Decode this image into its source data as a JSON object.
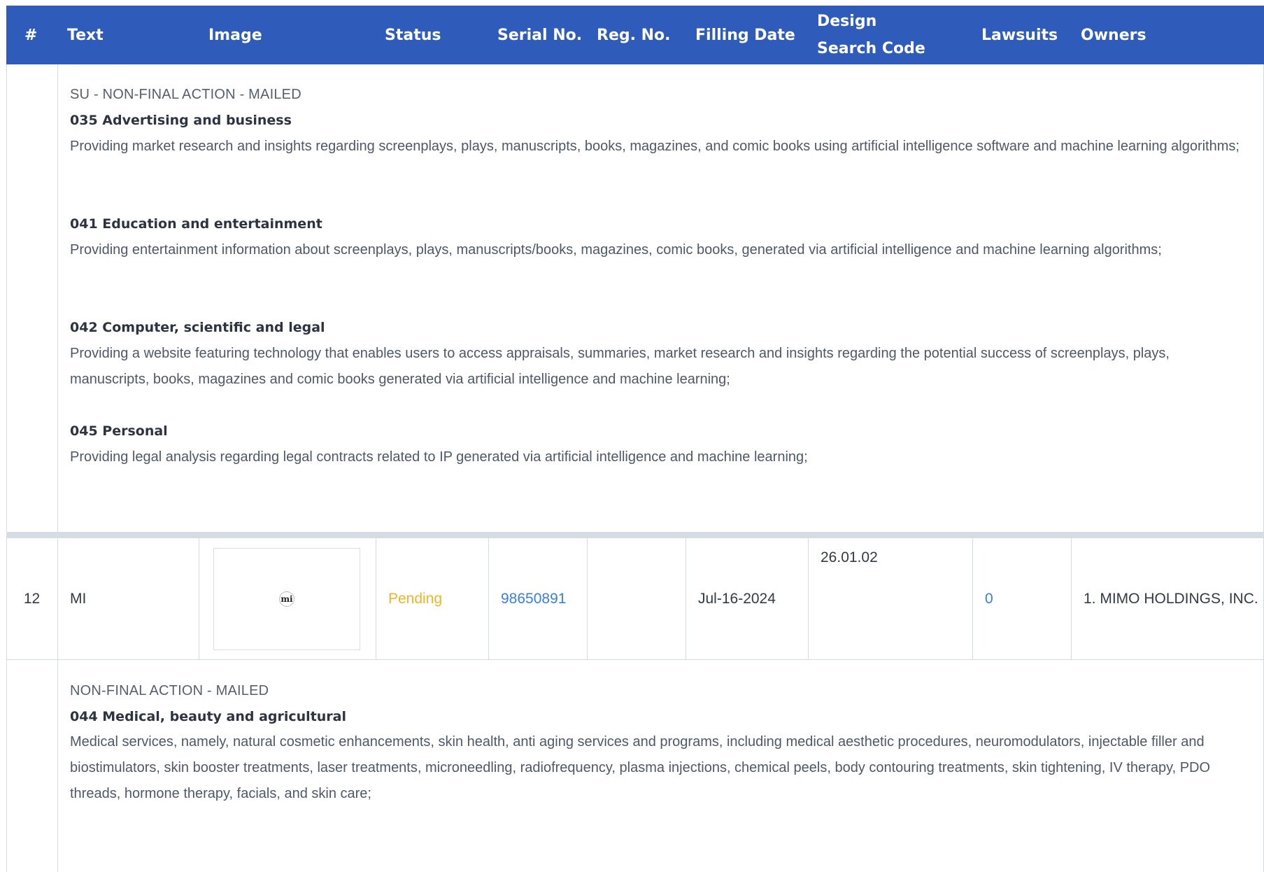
{
  "table": {
    "headers": [
      "#",
      "Text",
      "Image",
      "Status",
      "Serial No.",
      "Reg. No.",
      "Filling Date",
      "Design Search Code",
      "Lawsuits",
      "Owners"
    ]
  },
  "prev_detail": {
    "status_line": "SU - NON-FINAL ACTION - MAILED",
    "classes": [
      {
        "title": "035 Advertising and business",
        "desc": "Providing market research and insights regarding screenplays, plays, manuscripts, books, magazines, and comic books using artificial intelligence software and machine learning algorithms;"
      },
      {
        "title": "041 Education and entertainment",
        "desc": "Providing entertainment information about screenplays, plays, manuscripts/books, magazines, comic books, generated via artificial intelligence and machine learning algorithms;"
      },
      {
        "title": "042 Computer, scientific and legal",
        "desc": "Providing a website featuring technology that enables users to access appraisals, summaries, market research and insights regarding the potential success of screenplays, plays, manuscripts, books, magazines and comic books generated via artificial intelligence and machine learning;"
      },
      {
        "title": "045 Personal",
        "desc": "Providing legal analysis regarding legal contracts related to IP generated via artificial intelligence and machine learning;"
      }
    ]
  },
  "row": {
    "index": "12",
    "text": "MI",
    "image_logo": "mi",
    "status": "Pending",
    "serial_no": "98650891",
    "reg_no": "",
    "filling_date": "Jul-16-2024",
    "design_search_code": "26.01.02",
    "lawsuits": "0",
    "owners": "1. MIMO HOLDINGS, INC."
  },
  "row_detail": {
    "status_line": "NON-FINAL ACTION - MAILED",
    "classes": [
      {
        "title": "044 Medical, beauty and agricultural",
        "desc": "Medical services, namely, natural cosmetic enhancements, skin health, anti aging services and programs, including medical aesthetic procedures, neuromodulators, injectable filler and biostimulators, skin booster treatments, laser treatments, microneedling, radiofrequency, plasma injections, chemical peels, body contouring treatments, skin tightening, IV therapy, PDO threads, hormone therapy, facials, and skin care;"
      }
    ]
  },
  "colors": {
    "header_bg": "#2f5cba",
    "link": "#3a7fe0",
    "pending": "#f0b42c"
  }
}
